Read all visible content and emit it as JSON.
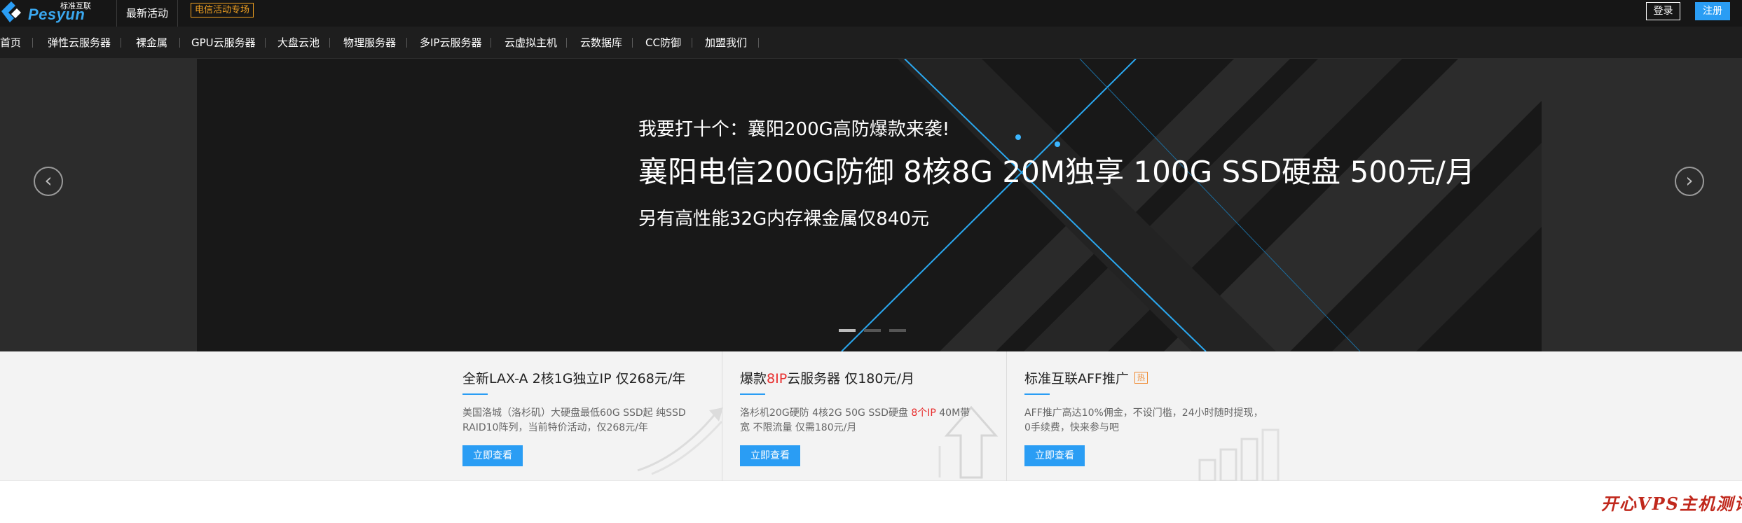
{
  "header": {
    "logo_text": "Pesyun",
    "logo_sub": "标准互联",
    "latest_activity": "最新活动",
    "telecom_tag": "电信活动专场",
    "login": "登录",
    "register": "注册"
  },
  "nav": {
    "items": [
      {
        "label": "首页"
      },
      {
        "label": "弹性云服务器"
      },
      {
        "label": "裸金属"
      },
      {
        "label": "GPU云服务器"
      },
      {
        "label": "大盘云池"
      },
      {
        "label": "物理服务器"
      },
      {
        "label": "多IP云服务器"
      },
      {
        "label": "云虚拟主机"
      },
      {
        "label": "云数据库"
      },
      {
        "label": "CC防御"
      },
      {
        "label": "加盟我们"
      }
    ]
  },
  "banner": {
    "line1": "我要打十个：襄阳200G高防爆款来袭!",
    "line2": "襄阳电信200G防御 8核8G 20M独享 100G SSD硬盘 500元/月",
    "line3": "另有高性能32G内存裸金属仅840元",
    "prev_glyph": "‹",
    "next_glyph": "›",
    "active_slide": 1,
    "slide_count": 3
  },
  "features": [
    {
      "title": "全新LAX-A 2核1G独立IP 仅268元/年",
      "desc": "美国洛城（洛杉矶）大硬盘最低60G SSD起 纯SSD RAID10阵列，当前特价活动，仅268元/年",
      "button": "立即查看"
    },
    {
      "title_pre": "爆款",
      "title_red": "8IP",
      "title_post": "云服务器 仅180元/月",
      "desc_pre": "洛杉机20G硬防 4核2G 50G SSD硬盘 ",
      "desc_red": "8个IP",
      "desc_post": " 40M带宽 不限流量 仅需180元/月",
      "button": "立即查看"
    },
    {
      "title": "标准互联AFF推广",
      "hot": "热",
      "desc": "AFF推广高达10%佣金，不设门槛，24小时随时提现，0手续费，快来参与吧",
      "button": "立即查看"
    }
  ],
  "watermark": "开心VPS主机测评",
  "colors": {
    "accent": "#2a9df4",
    "topbar": "#161616",
    "nav": "#1e1e1e",
    "banner": "#181818",
    "tag": "#f0a020",
    "highlight": "#e82e2e"
  }
}
